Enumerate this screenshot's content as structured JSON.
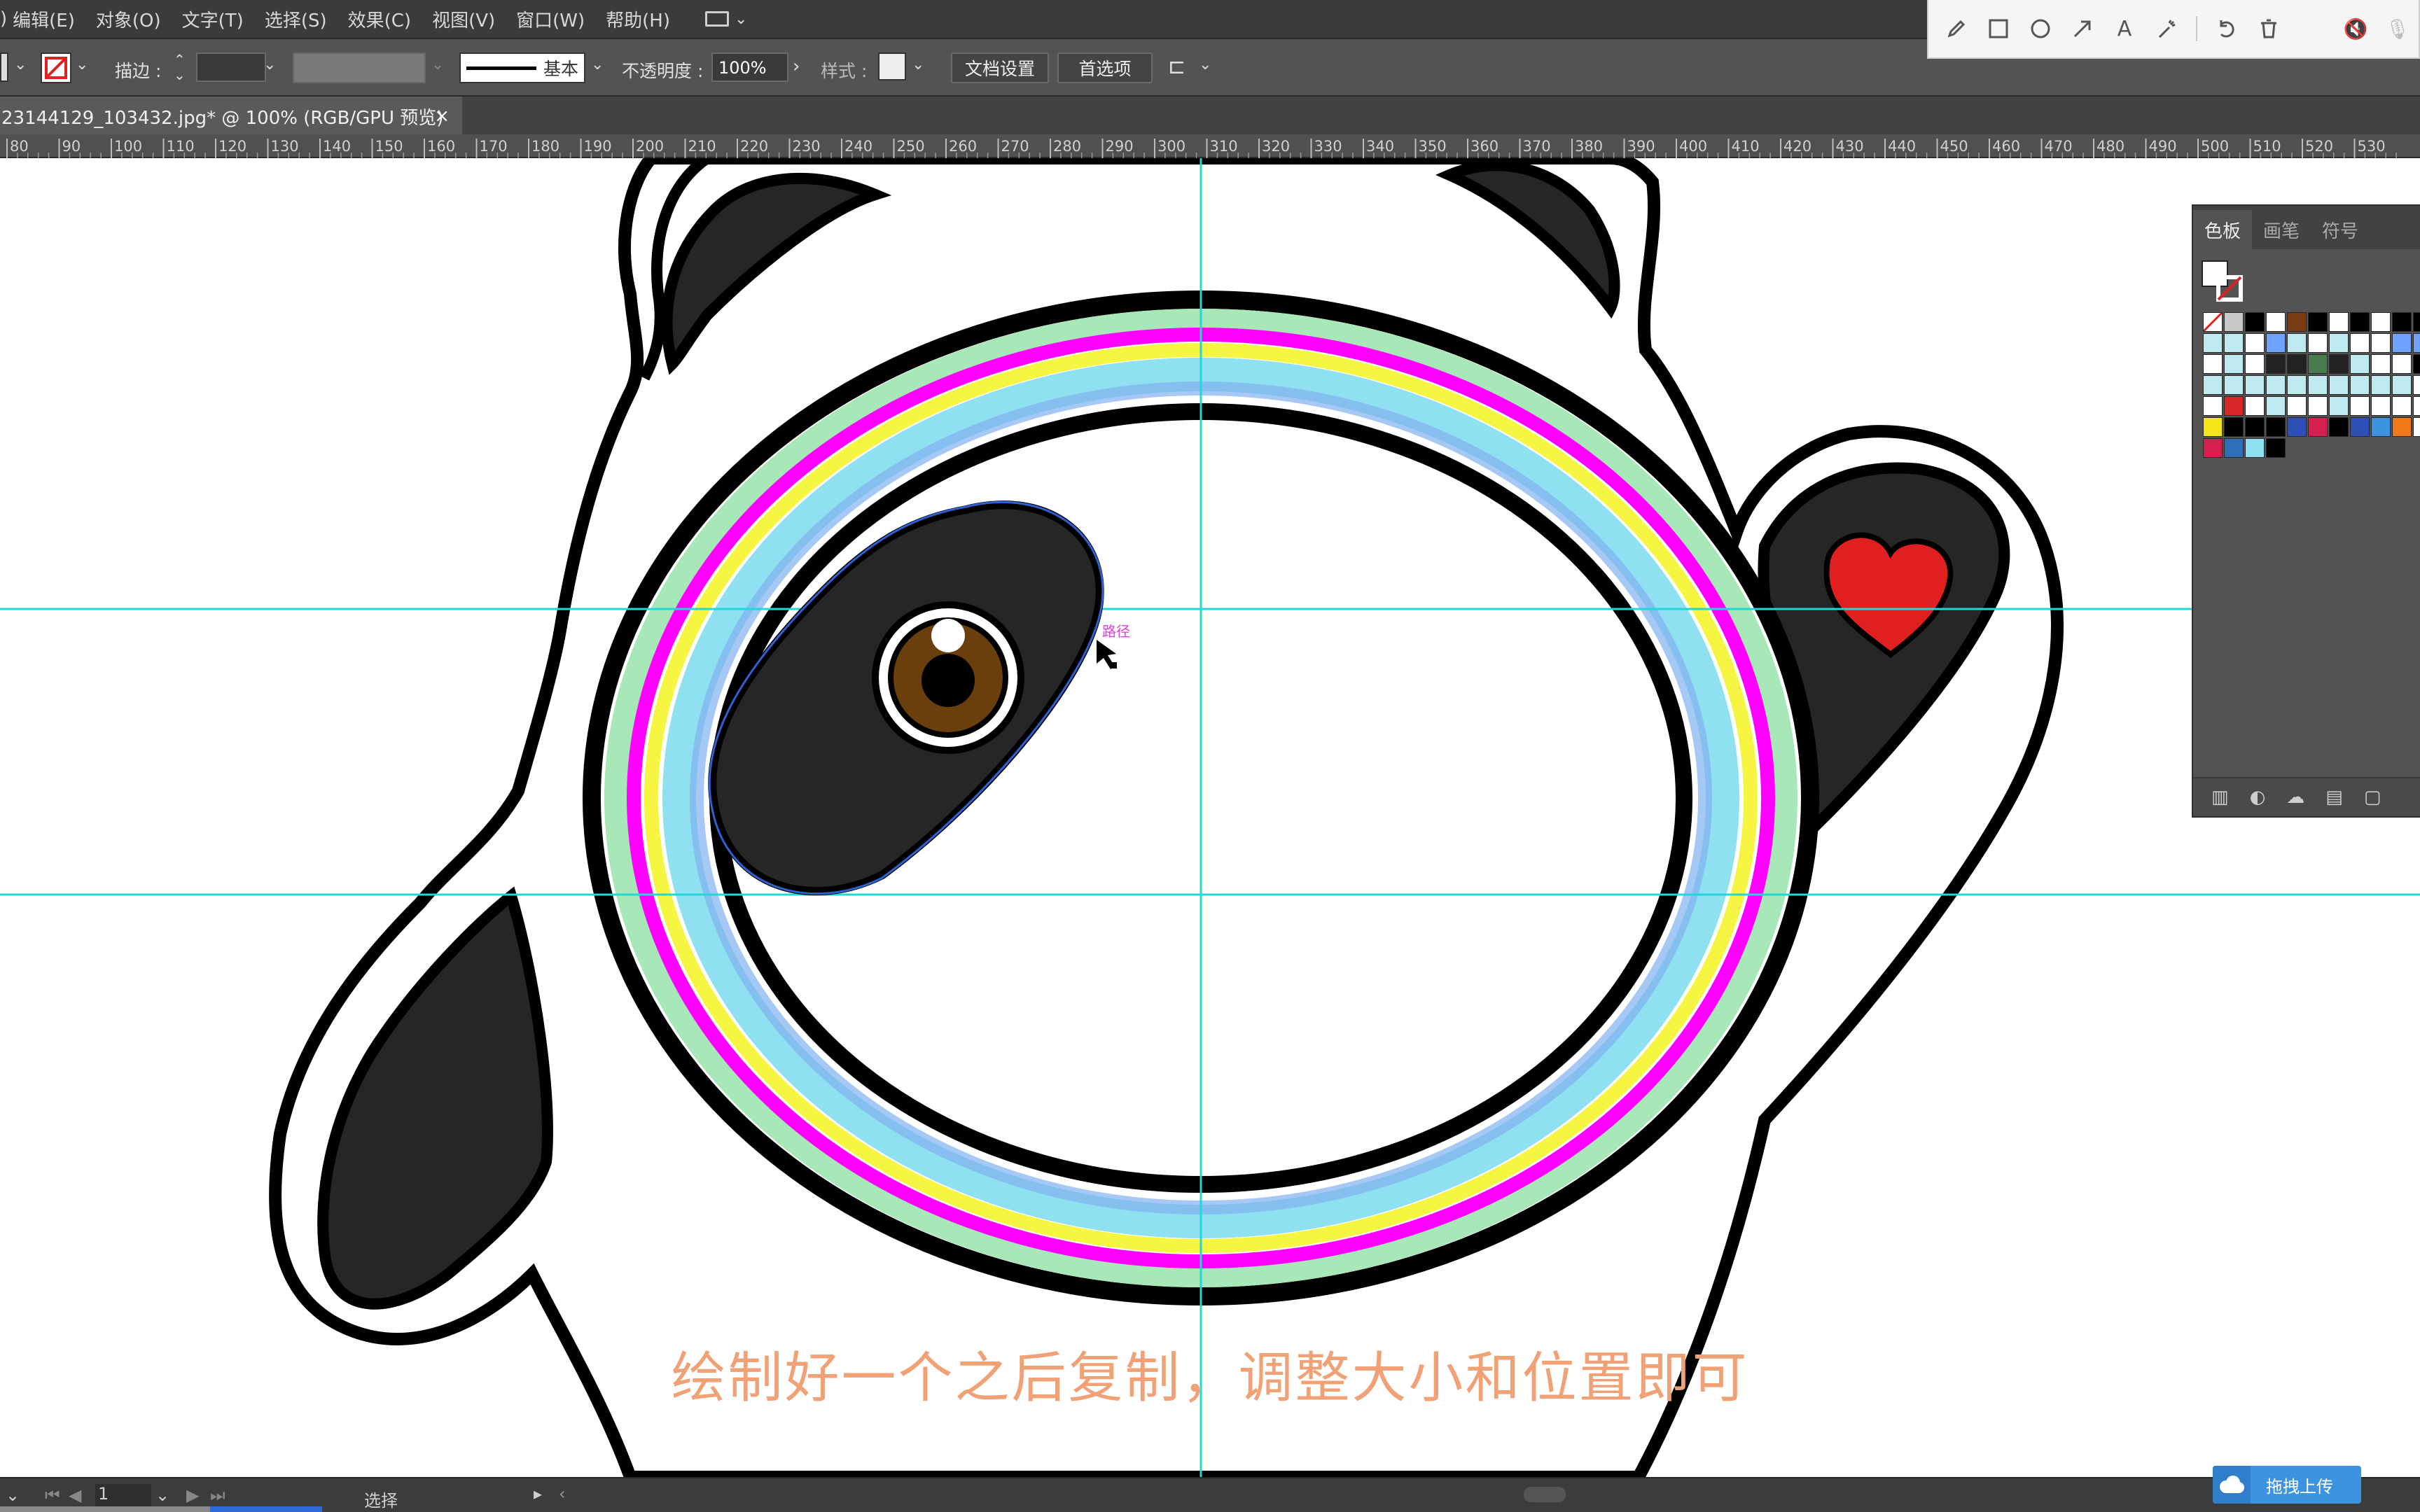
{
  "menu": {
    "items": [
      "编辑(E)",
      "对象(O)",
      "文字(T)",
      "选择(S)",
      "效果(C)",
      "视图(V)",
      "窗口(W)",
      "帮助(H)"
    ]
  },
  "control_bar": {
    "stroke_label": "描边 :",
    "brush_label": "基本",
    "opacity_label": "不透明度 :",
    "opacity_value": "100%",
    "style_label": "样式 :",
    "doc_settings": "文档设置",
    "preferences": "首选项"
  },
  "document_tab": {
    "title": "23144129_103432.jpg*  @  100%  (RGB/GPU 预览)",
    "close": "×"
  },
  "ruler": {
    "labels": [
      "80",
      "90",
      "100",
      "110",
      "120",
      "130",
      "140",
      "150",
      "160",
      "170",
      "180",
      "190",
      "200",
      "210",
      "220",
      "230",
      "240",
      "250",
      "260",
      "270",
      "280",
      "290",
      "300",
      "310",
      "320",
      "330",
      "340",
      "350",
      "360",
      "370",
      "380",
      "390",
      "400",
      "410",
      "420",
      "430",
      "440",
      "450",
      "460",
      "470",
      "480",
      "490",
      "500",
      "510",
      "520",
      "530"
    ]
  },
  "canvas": {
    "hover_label": "路径",
    "subtitle": "绘制好一个之后复制，调整大小和位置即可"
  },
  "swatches_panel": {
    "tabs": [
      "色板",
      "画笔",
      "符号"
    ],
    "colors": [
      "#ffffff",
      "#c8c8c8",
      "#000000",
      "#ffffff",
      "#7a3b12",
      "#000000",
      "#ffffff",
      "#000000",
      "#ffffff",
      "#000000",
      "#000000",
      "#bfeaf0",
      "#bfeaf0",
      "#ffffff",
      "#6fa3ff",
      "#bfeaf0",
      "#ffffff",
      "#bfeaf0",
      "#ffffff",
      "#ffffff",
      "#6fa3ff",
      "#6fa3ff",
      "#ffffff",
      "#bfeaf0",
      "#ffffff",
      "#222222",
      "#222222",
      "#4a7a50",
      "#222222",
      "#bfeaf0",
      "#ffffff",
      "#ffffff",
      "#000000",
      "#bfeaf0",
      "#bfeaf0",
      "#bfeaf0",
      "#bfeaf0",
      "#bfeaf0",
      "#bfeaf0",
      "#bfeaf0",
      "#bfeaf0",
      "#bfeaf0",
      "#bfeaf0",
      "#ffffff",
      "#ffffff",
      "#d62828",
      "#ffffff",
      "#bfeaf0",
      "#ffffff",
      "#ffffff",
      "#bfeaf0",
      "#ffffff",
      "#ffffff",
      "#ffffff",
      "#ffffff",
      "#f5e61a",
      "#000000",
      "#000000",
      "#000000",
      "#2e4fb8",
      "#d61f4f",
      "#000000",
      "#2e4fb8",
      "#3c93e0",
      "#f07a1a",
      "#ffffff",
      "#d61f4f",
      "#2e6fb8",
      "#8fe0f0",
      "#000000"
    ]
  },
  "status_bar": {
    "page": "1",
    "mode": "选择"
  },
  "upload_button": {
    "label": "拖拽上传"
  },
  "colors": {
    "accent_cyan": "#1fd8d8",
    "magenta": "#ff00ff",
    "yellow": "#f5f542",
    "heart_red": "#e02020",
    "eye_brown": "#6b3e0e",
    "subtitle_orange": "#f0a276"
  }
}
